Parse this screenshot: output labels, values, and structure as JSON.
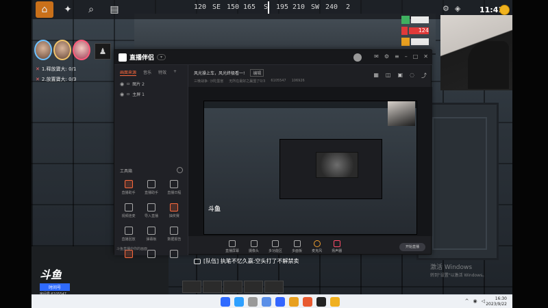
{
  "hud": {
    "compass": [
      "120",
      "SE",
      "150",
      "165",
      "S",
      "195",
      "210",
      "SW",
      "240",
      "2"
    ],
    "clock": "11:41",
    "stats": [
      {
        "color": "#3fb060",
        "value": ""
      },
      {
        "color": "#e03a3a",
        "value": "124"
      },
      {
        "color": "#e8a020",
        "value": ""
      }
    ]
  },
  "missions": [
    {
      "label": "1.释放寶大: 0/1"
    },
    {
      "label": "2.放置寶大: 0/3"
    }
  ],
  "app": {
    "logo": "直播伴侣",
    "title": "风光操上车，风光终极看一!",
    "edit_btn": "编辑",
    "sub_info": [
      "三棱战争: 沙陀墨宫",
      "无所在最好之赢盟了0/3",
      "6105547",
      "106926"
    ],
    "side_tabs": [
      "画面来源",
      "音乐",
      "特效"
    ],
    "layers": [
      {
        "label": "图片 2"
      },
      {
        "label": "主屏 1"
      }
    ],
    "toolbox_title": "工具箱",
    "tools": [
      {
        "label": "直播助手",
        "hot": true
      },
      {
        "label": "直播助手",
        "hot": false
      },
      {
        "label": "直播日程",
        "hot": false
      },
      {
        "label": "视频连麦",
        "hot": false
      },
      {
        "label": "导入直播",
        "hot": false
      },
      {
        "label": "抽奖赛",
        "hot": true
      },
      {
        "label": "直播回放",
        "hot": false
      },
      {
        "label": "弹幕板",
        "hot": false
      },
      {
        "label": "数据报告",
        "hot": false
      },
      {
        "label": "",
        "hot": true
      },
      {
        "label": "",
        "hot": false
      },
      {
        "label": "",
        "hot": false
      }
    ],
    "status": "斗鱼直播中你的画面",
    "bottom": [
      {
        "label": "直播屏幕",
        "kind": "normal"
      },
      {
        "label": "摄像头",
        "kind": "normal"
      },
      {
        "label": "多功能区",
        "kind": "normal"
      },
      {
        "label": "多面板",
        "kind": "normal"
      },
      {
        "label": "麦克风",
        "kind": "mic"
      },
      {
        "label": "扬声器",
        "kind": "spk"
      }
    ],
    "go_live": "开始直播"
  },
  "chat": "[队伍] 执笔不忆久赢:空头打了不解禁卖",
  "watermark": {
    "line1": "激活 Windows",
    "line2": "转到\"设置\"以激活 Windows。"
  },
  "douyu": {
    "logo": "斗鱼",
    "badge": "时间号",
    "room": "房间号:6105547"
  },
  "taskbar": {
    "icons": [
      "#2f6bff",
      "#2ea0ff",
      "#999999",
      "#5a8fe8",
      "#3366ff",
      "#e8a020",
      "#e85a30",
      "#222222",
      "#f0b020"
    ],
    "time": "16:30",
    "date": "2023/9/22"
  }
}
